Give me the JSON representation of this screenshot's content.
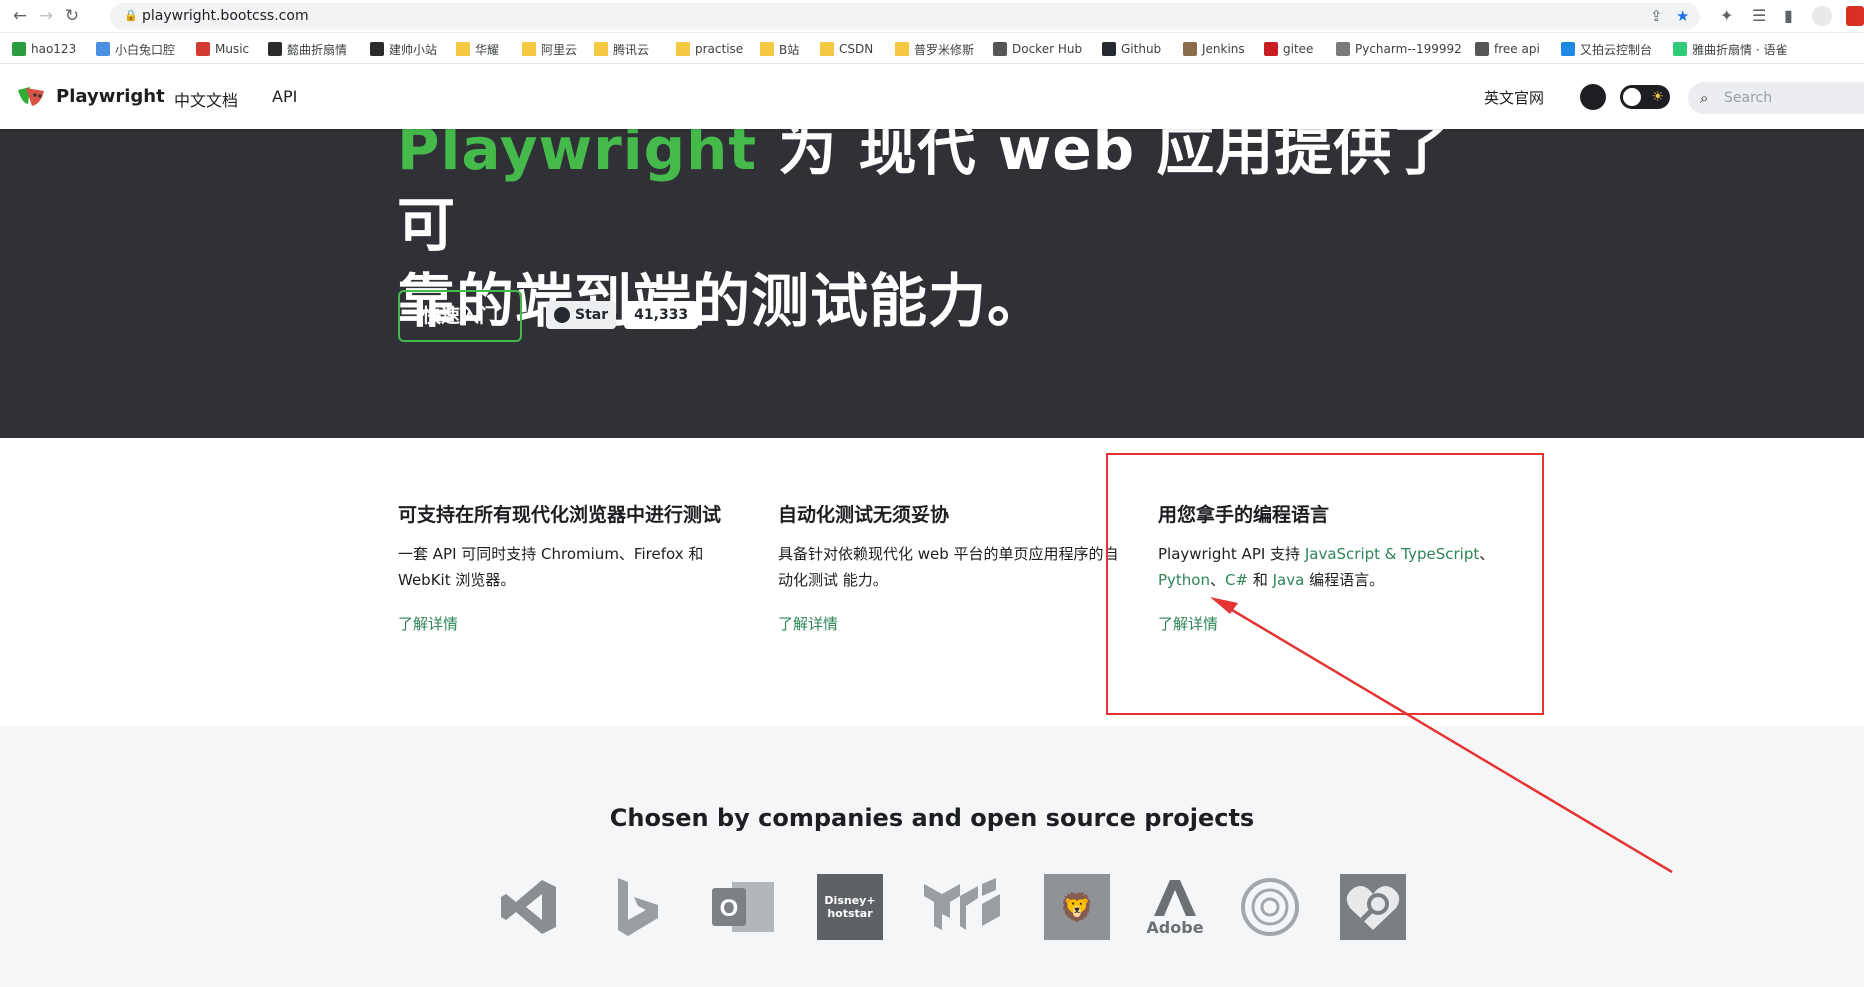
{
  "browser": {
    "url": "playwright.bootcss.com",
    "bookmarks": [
      {
        "label": "hao123",
        "icon": "hao123-icon"
      },
      {
        "label": "小白兔口腔",
        "icon": "tooth-icon"
      },
      {
        "label": "Music",
        "icon": "netease-music-icon"
      },
      {
        "label": "懿曲折扇情",
        "icon": "site-icon"
      },
      {
        "label": "建帅小站",
        "icon": "site-icon"
      },
      {
        "label": "华耀",
        "icon": "folder-icon"
      },
      {
        "label": "阿里云",
        "icon": "folder-icon"
      },
      {
        "label": "腾讯云",
        "icon": "folder-icon"
      },
      {
        "label": "practise",
        "icon": "folder-icon"
      },
      {
        "label": "B站",
        "icon": "folder-icon"
      },
      {
        "label": "CSDN",
        "icon": "folder-icon"
      },
      {
        "label": "普罗米修斯",
        "icon": "folder-icon"
      },
      {
        "label": "Docker Hub",
        "icon": "docker-icon"
      },
      {
        "label": "Github",
        "icon": "github-icon"
      },
      {
        "label": "Jenkins",
        "icon": "jenkins-icon"
      },
      {
        "label": "gitee",
        "icon": "gitee-icon"
      },
      {
        "label": "Pycharm--199992",
        "icon": "pycharm-icon"
      },
      {
        "label": "free api",
        "icon": "globe-icon"
      },
      {
        "label": "又拍云控制台",
        "icon": "upyun-icon"
      },
      {
        "label": "雅曲折扇情 · 语雀",
        "icon": "yuque-icon"
      }
    ]
  },
  "site": {
    "brand": "Playwright",
    "nav_docs": "中文文档",
    "nav_api": "API",
    "nav_english": "英文官网",
    "search_placeholder": "Search"
  },
  "hero": {
    "title_highlight": "Playwright",
    "title_rest_line1": " 为 现代 web 应用提供了可",
    "title_line2": "靠的端到端的测试能力。",
    "quick_start": "快速入门",
    "star_label": "Star",
    "star_count": "41,333"
  },
  "features": [
    {
      "title": "可支持在所有现代化浏览器中进行测试",
      "desc": "一套 API 可同时支持 Chromium、Firefox 和 WebKit 浏览器。",
      "more": "了解详情"
    },
    {
      "title": "自动化测试无须妥协",
      "desc": "具备针对依赖现代化 web 平台的单页应用程序的自动化测试 能力。",
      "more": "了解详情"
    },
    {
      "title": "用您拿手的编程语言",
      "desc_prefix": "Playwright API 支持 ",
      "lang_js": "JavaScript & TypeScript",
      "sep1": "、",
      "lang_py": "Python",
      "sep2": "、",
      "lang_cs": "C#",
      "and": " 和 ",
      "lang_java": "Java",
      "desc_suffix": " 编程语言。",
      "more": "了解详情"
    }
  ],
  "companies": {
    "title": "Chosen by companies and open source projects",
    "logos": [
      {
        "name": "VS Code",
        "icon": "vscode-icon"
      },
      {
        "name": "Bing",
        "icon": "bing-icon"
      },
      {
        "name": "Outlook",
        "icon": "outlook-icon",
        "text": "O"
      },
      {
        "name": "Disney+ Hotstar",
        "icon": "hotstar-icon",
        "text": "Disney+ hotstar"
      },
      {
        "name": "Material UI",
        "icon": "material-ui-icon"
      },
      {
        "name": "ING",
        "icon": "ing-lion-icon"
      },
      {
        "name": "Adobe",
        "icon": "adobe-icon",
        "text": "Adobe"
      },
      {
        "name": "React Navigation",
        "icon": "react-navigation-icon"
      },
      {
        "name": "Accessibility Insights",
        "icon": "accessibility-insights-icon"
      }
    ]
  },
  "colors": {
    "accent_green": "#45ba4b",
    "link_green": "#2e8555",
    "hero_bg": "#2f3136",
    "annotation_red": "#e63333"
  }
}
